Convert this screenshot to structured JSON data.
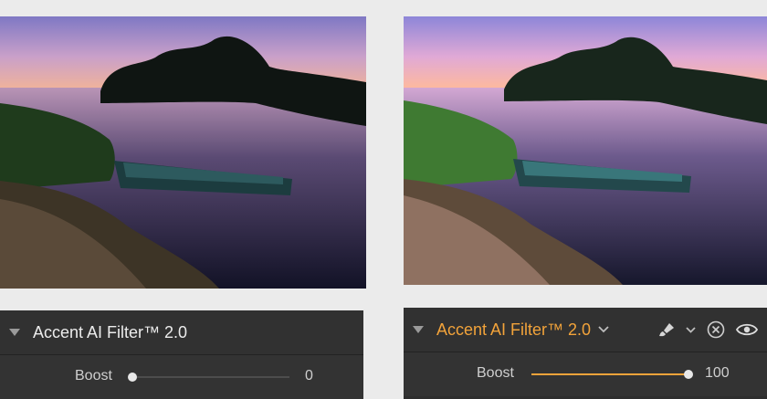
{
  "colors": {
    "accent": "#f2a33a",
    "panel_bg": "#2e2e2e",
    "page_bg": "#ebebeb"
  },
  "left_panel": {
    "title": "Accent AI Filter™ 2.0",
    "boost_label": "Boost",
    "boost_value": "0",
    "boost_fraction": 0
  },
  "right_panel": {
    "title": "Accent AI Filter™ 2.0",
    "boost_label": "Boost",
    "boost_value": "100",
    "boost_fraction": 1,
    "icons": [
      "brush-icon",
      "chevron-down-icon",
      "close-circle-icon",
      "eye-icon"
    ]
  }
}
